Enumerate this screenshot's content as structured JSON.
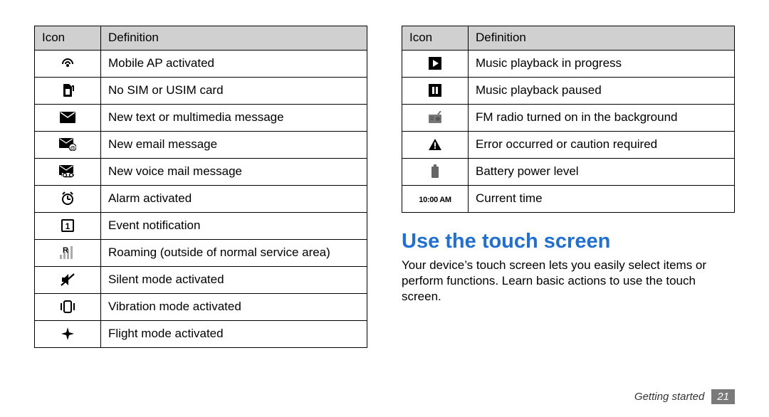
{
  "tables": {
    "left": {
      "headers": [
        "Icon",
        "Definition"
      ],
      "rows": [
        {
          "icon": "mobile-ap-icon",
          "definition": "Mobile AP activated"
        },
        {
          "icon": "no-sim-icon",
          "definition": "No SIM or USIM card"
        },
        {
          "icon": "new-message-icon",
          "definition": "New text or multimedia message"
        },
        {
          "icon": "new-email-icon",
          "definition": "New email message"
        },
        {
          "icon": "new-voicemail-icon",
          "definition": "New voice mail message"
        },
        {
          "icon": "alarm-icon",
          "definition": "Alarm activated"
        },
        {
          "icon": "event-icon",
          "definition": "Event notification"
        },
        {
          "icon": "roaming-icon",
          "definition": "Roaming (outside of normal service area)"
        },
        {
          "icon": "silent-mode-icon",
          "definition": "Silent mode activated"
        },
        {
          "icon": "vibration-icon",
          "definition": "Vibration mode activated"
        },
        {
          "icon": "flight-mode-icon",
          "definition": "Flight mode activated"
        }
      ]
    },
    "right": {
      "headers": [
        "Icon",
        "Definition"
      ],
      "rows": [
        {
          "icon": "music-play-icon",
          "definition": "Music playback in progress"
        },
        {
          "icon": "music-pause-icon",
          "definition": "Music playback paused"
        },
        {
          "icon": "fm-radio-icon",
          "definition": "FM radio turned on in the background"
        },
        {
          "icon": "error-icon",
          "definition": "Error occurred or caution required"
        },
        {
          "icon": "battery-icon",
          "definition": "Battery power level"
        },
        {
          "icon": "time-icon",
          "icon_text": "10:00 AM",
          "definition": "Current time"
        }
      ]
    }
  },
  "section": {
    "title": "Use the touch screen",
    "body": "Your device’s touch screen lets you easily select items or perform functions. Learn basic actions to use the touch screen."
  },
  "footer": {
    "chapter": "Getting started",
    "page": "21"
  }
}
